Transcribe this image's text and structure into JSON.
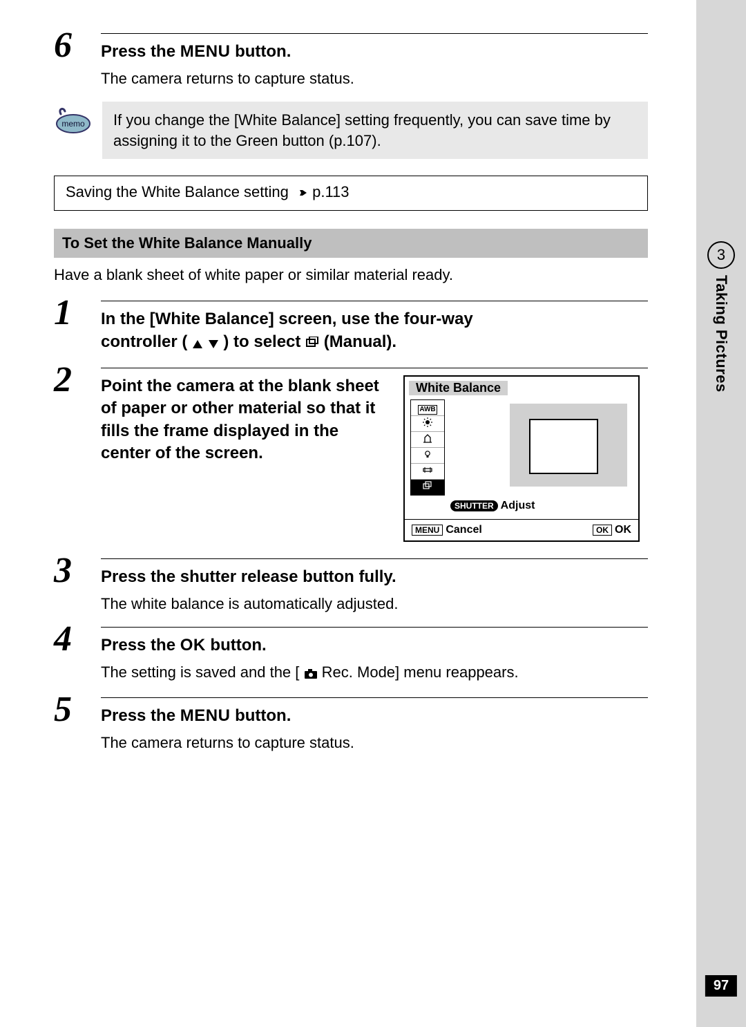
{
  "sidebar": {
    "chapter_num": "3",
    "chapter_label": "Taking Pictures",
    "page_num": "97"
  },
  "step6": {
    "num": "6",
    "head_pre": "Press the ",
    "head_btn": "MENU",
    "head_post": " button.",
    "body": "The camera returns to capture status."
  },
  "memo": {
    "text": "If you change the [White Balance] setting frequently, you can save time by assigning it to the Green button (p.107)."
  },
  "crossref": {
    "text_pre": "Saving the White Balance setting ",
    "text_post": "p.113"
  },
  "section": {
    "title": "To Set the White Balance Manually",
    "intro": "Have a blank sheet of white paper or similar material ready."
  },
  "mstep1": {
    "num": "1",
    "line1": "In the [White Balance] screen, use the four-way",
    "line2_pre": "controller (",
    "line2_post": ") to select ",
    "manual_label": " (Manual)."
  },
  "mstep2": {
    "num": "2",
    "head": "Point the camera at the blank sheet of paper or other material so that it fills the frame displayed in the center of the screen."
  },
  "wb": {
    "title": "White Balance",
    "awb": "AWB",
    "adjust": "Adjust",
    "shutter_chip": "SHUTTER",
    "cancel": "Cancel",
    "menu_chip": "MENU",
    "ok": "OK",
    "ok_chip": "OK"
  },
  "mstep3": {
    "num": "3",
    "head": "Press the shutter release button fully.",
    "body": "The white balance is automatically adjusted."
  },
  "mstep4": {
    "num": "4",
    "head_pre": "Press the ",
    "head_btn": "OK",
    "head_post": " button.",
    "body_pre": "The setting is saved and the [",
    "body_post": " Rec. Mode] menu reappears."
  },
  "mstep5": {
    "num": "5",
    "head_pre": "Press the ",
    "head_btn": "MENU",
    "head_post": " button.",
    "body": "The camera returns to capture status."
  }
}
